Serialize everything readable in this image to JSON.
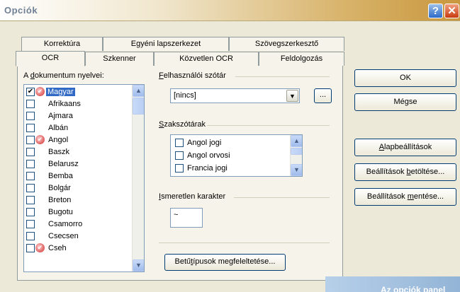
{
  "window": {
    "title": "Opciók",
    "help_glyph": "?",
    "close_glyph": "✕"
  },
  "tabs": {
    "back": [
      {
        "label": "Korrektúra"
      },
      {
        "label": "Egyéni lapszerkezet"
      },
      {
        "label": "Szövegszerkesztő"
      }
    ],
    "front": [
      {
        "label": "OCR"
      },
      {
        "label": "Szkenner"
      },
      {
        "label": "Közvetlen OCR"
      },
      {
        "label": "Feldolgozás"
      }
    ]
  },
  "languages": {
    "label_pre": "A ",
    "label_key": "d",
    "label_post": "okumentum nyelvei:",
    "items": [
      {
        "label": "Magyar",
        "checked": true,
        "flag": true,
        "selected": true
      },
      {
        "label": "Afrikaans",
        "checked": false,
        "flag": false
      },
      {
        "label": "Ajmara",
        "checked": false,
        "flag": false
      },
      {
        "label": "Albán",
        "checked": false,
        "flag": false
      },
      {
        "label": "Angol",
        "checked": false,
        "flag": true
      },
      {
        "label": "Baszk",
        "checked": false,
        "flag": false
      },
      {
        "label": "Belarusz",
        "checked": false,
        "flag": false
      },
      {
        "label": "Bemba",
        "checked": false,
        "flag": false
      },
      {
        "label": "Bolgár",
        "checked": false,
        "flag": false
      },
      {
        "label": "Breton",
        "checked": false,
        "flag": false
      },
      {
        "label": "Bugotu",
        "checked": false,
        "flag": false
      },
      {
        "label": "Csamorro",
        "checked": false,
        "flag": false
      },
      {
        "label": "Csecsen",
        "checked": false,
        "flag": false
      },
      {
        "label": "Cseh",
        "checked": false,
        "flag": true
      }
    ]
  },
  "user_dict": {
    "label_key": "F",
    "label_post": "elhasználói szótár",
    "value": "[nincs]",
    "browse": "..."
  },
  "special_dicts": {
    "label_key": "S",
    "label_post": "zakszótárak",
    "items": [
      {
        "label": "Angol jogi",
        "checked": false
      },
      {
        "label": "Angol orvosi",
        "checked": false
      },
      {
        "label": "Francia jogi",
        "checked": false
      }
    ]
  },
  "unknown_char": {
    "label_key": "I",
    "label_post": "smeretlen karakter",
    "value": "~"
  },
  "font_button": {
    "pre": "Betű",
    "key": "t",
    "post": "ípusok megfeleltetése..."
  },
  "buttons": {
    "ok": "OK",
    "cancel": "Mégse",
    "defaults_key": "A",
    "defaults_post": "lapbeállítások",
    "load_pre": "Beállítások ",
    "load_key": "b",
    "load_post": "etöltése...",
    "save_pre": "Beállítások ",
    "save_key": "m",
    "save_post": "entése..."
  },
  "overlay_text": "Az opciók panel",
  "colors": {
    "selection": "#316ac5",
    "accent_title": "#d8b36a",
    "close": "#c83a10"
  }
}
